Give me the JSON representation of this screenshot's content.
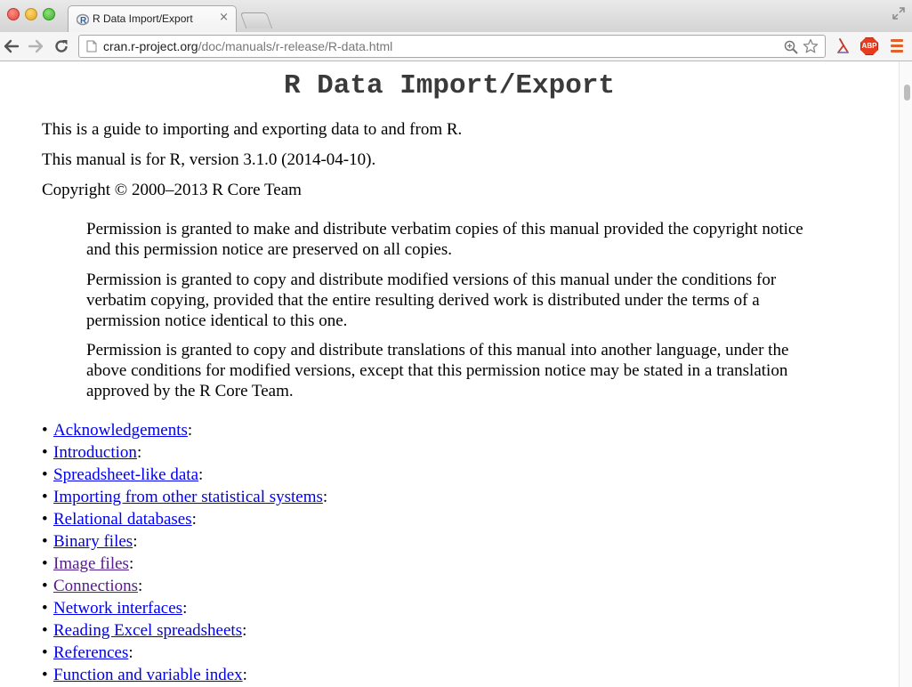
{
  "browser": {
    "tab_title": "R Data Import/Export",
    "tab_close": "×",
    "url_host": "cran.r-project.org",
    "url_path": "/doc/manuals/r-release/R-data.html",
    "extension_abp_label": "ABP"
  },
  "page": {
    "title": "R Data Import/Export",
    "intro": "This is a guide to importing and exporting data to and from R.",
    "version_line": "This manual is for R, version 3.1.0 (2014-04-10).",
    "copyright": "Copyright © 2000–2013 R Core Team",
    "permissions": [
      "Permission is granted to make and distribute verbatim copies of this manual provided the copyright notice and this permission notice are preserved on all copies.",
      "Permission is granted to copy and distribute modified versions of this manual under the conditions for verbatim copying, provided that the entire resulting derived work is distributed under the terms of a permission notice identical to this one.",
      "Permission is granted to copy and distribute translations of this manual into another language, under the above conditions for modified versions, except that this permission notice may be stated in a translation approved by the R Core Team."
    ],
    "bullet": "•",
    "toc_suffix": ":",
    "toc": [
      {
        "label": "Acknowledgements",
        "visited": false
      },
      {
        "label": "Introduction",
        "visited": false
      },
      {
        "label": "Spreadsheet-like data",
        "visited": false
      },
      {
        "label": "Importing from other statistical systems",
        "visited": false
      },
      {
        "label": "Relational databases",
        "visited": false
      },
      {
        "label": "Binary files",
        "visited": false
      },
      {
        "label": "Image files",
        "visited": true
      },
      {
        "label": "Connections",
        "visited": true
      },
      {
        "label": "Network interfaces",
        "visited": false
      },
      {
        "label": "Reading Excel spreadsheets",
        "visited": false
      },
      {
        "label": "References",
        "visited": false
      },
      {
        "label": "Function and variable index",
        "visited": false
      }
    ]
  },
  "colors": {
    "link": "#0000ee",
    "visited_link": "#551a8b",
    "title": "#3a3a3a"
  }
}
